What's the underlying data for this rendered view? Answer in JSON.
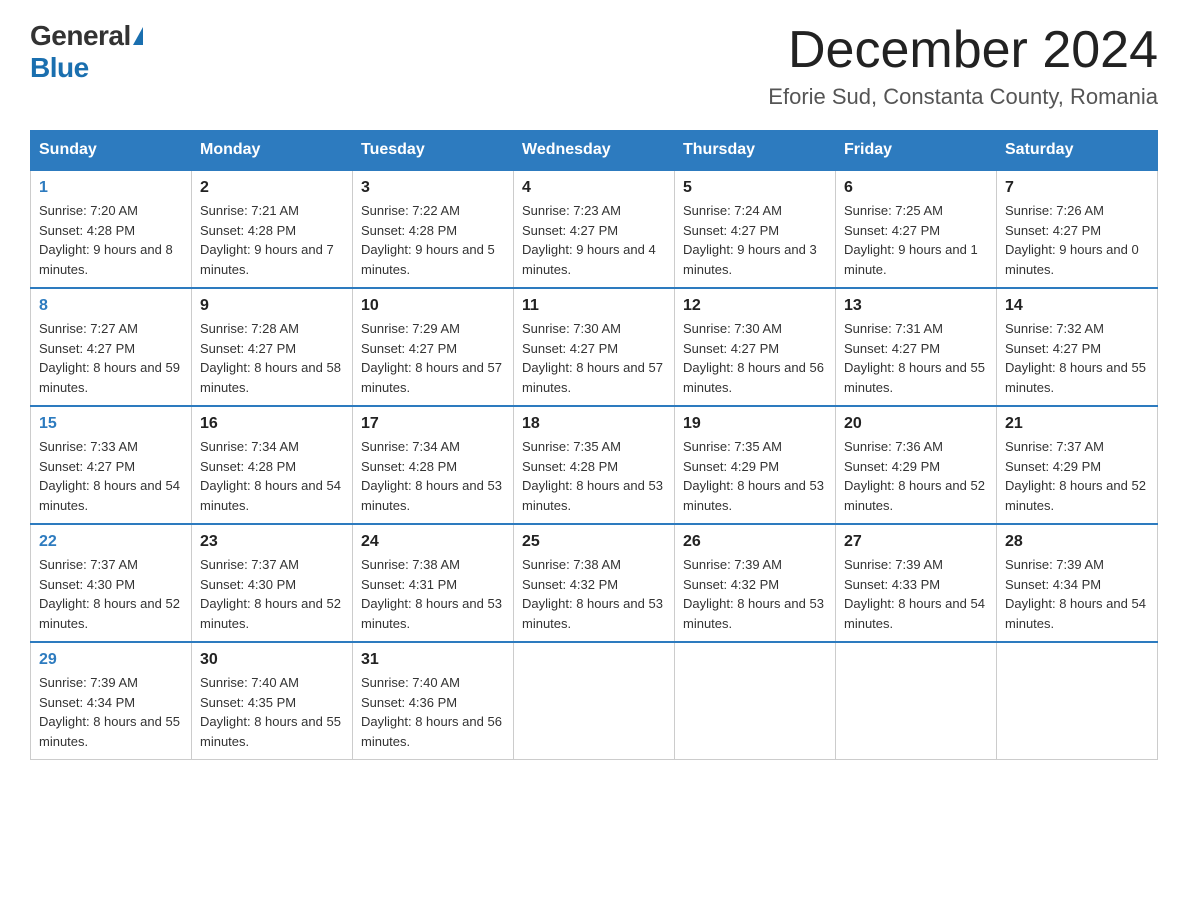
{
  "header": {
    "logo_general": "General",
    "logo_blue": "Blue",
    "month_title": "December 2024",
    "location": "Eforie Sud, Constanta County, Romania"
  },
  "days_of_week": [
    "Sunday",
    "Monday",
    "Tuesday",
    "Wednesday",
    "Thursday",
    "Friday",
    "Saturday"
  ],
  "weeks": [
    [
      {
        "day": "1",
        "sunrise": "7:20 AM",
        "sunset": "4:28 PM",
        "daylight": "9 hours and 8 minutes."
      },
      {
        "day": "2",
        "sunrise": "7:21 AM",
        "sunset": "4:28 PM",
        "daylight": "9 hours and 7 minutes."
      },
      {
        "day": "3",
        "sunrise": "7:22 AM",
        "sunset": "4:28 PM",
        "daylight": "9 hours and 5 minutes."
      },
      {
        "day": "4",
        "sunrise": "7:23 AM",
        "sunset": "4:27 PM",
        "daylight": "9 hours and 4 minutes."
      },
      {
        "day": "5",
        "sunrise": "7:24 AM",
        "sunset": "4:27 PM",
        "daylight": "9 hours and 3 minutes."
      },
      {
        "day": "6",
        "sunrise": "7:25 AM",
        "sunset": "4:27 PM",
        "daylight": "9 hours and 1 minute."
      },
      {
        "day": "7",
        "sunrise": "7:26 AM",
        "sunset": "4:27 PM",
        "daylight": "9 hours and 0 minutes."
      }
    ],
    [
      {
        "day": "8",
        "sunrise": "7:27 AM",
        "sunset": "4:27 PM",
        "daylight": "8 hours and 59 minutes."
      },
      {
        "day": "9",
        "sunrise": "7:28 AM",
        "sunset": "4:27 PM",
        "daylight": "8 hours and 58 minutes."
      },
      {
        "day": "10",
        "sunrise": "7:29 AM",
        "sunset": "4:27 PM",
        "daylight": "8 hours and 57 minutes."
      },
      {
        "day": "11",
        "sunrise": "7:30 AM",
        "sunset": "4:27 PM",
        "daylight": "8 hours and 57 minutes."
      },
      {
        "day": "12",
        "sunrise": "7:30 AM",
        "sunset": "4:27 PM",
        "daylight": "8 hours and 56 minutes."
      },
      {
        "day": "13",
        "sunrise": "7:31 AM",
        "sunset": "4:27 PM",
        "daylight": "8 hours and 55 minutes."
      },
      {
        "day": "14",
        "sunrise": "7:32 AM",
        "sunset": "4:27 PM",
        "daylight": "8 hours and 55 minutes."
      }
    ],
    [
      {
        "day": "15",
        "sunrise": "7:33 AM",
        "sunset": "4:27 PM",
        "daylight": "8 hours and 54 minutes."
      },
      {
        "day": "16",
        "sunrise": "7:34 AM",
        "sunset": "4:28 PM",
        "daylight": "8 hours and 54 minutes."
      },
      {
        "day": "17",
        "sunrise": "7:34 AM",
        "sunset": "4:28 PM",
        "daylight": "8 hours and 53 minutes."
      },
      {
        "day": "18",
        "sunrise": "7:35 AM",
        "sunset": "4:28 PM",
        "daylight": "8 hours and 53 minutes."
      },
      {
        "day": "19",
        "sunrise": "7:35 AM",
        "sunset": "4:29 PM",
        "daylight": "8 hours and 53 minutes."
      },
      {
        "day": "20",
        "sunrise": "7:36 AM",
        "sunset": "4:29 PM",
        "daylight": "8 hours and 52 minutes."
      },
      {
        "day": "21",
        "sunrise": "7:37 AM",
        "sunset": "4:29 PM",
        "daylight": "8 hours and 52 minutes."
      }
    ],
    [
      {
        "day": "22",
        "sunrise": "7:37 AM",
        "sunset": "4:30 PM",
        "daylight": "8 hours and 52 minutes."
      },
      {
        "day": "23",
        "sunrise": "7:37 AM",
        "sunset": "4:30 PM",
        "daylight": "8 hours and 52 minutes."
      },
      {
        "day": "24",
        "sunrise": "7:38 AM",
        "sunset": "4:31 PM",
        "daylight": "8 hours and 53 minutes."
      },
      {
        "day": "25",
        "sunrise": "7:38 AM",
        "sunset": "4:32 PM",
        "daylight": "8 hours and 53 minutes."
      },
      {
        "day": "26",
        "sunrise": "7:39 AM",
        "sunset": "4:32 PM",
        "daylight": "8 hours and 53 minutes."
      },
      {
        "day": "27",
        "sunrise": "7:39 AM",
        "sunset": "4:33 PM",
        "daylight": "8 hours and 54 minutes."
      },
      {
        "day": "28",
        "sunrise": "7:39 AM",
        "sunset": "4:34 PM",
        "daylight": "8 hours and 54 minutes."
      }
    ],
    [
      {
        "day": "29",
        "sunrise": "7:39 AM",
        "sunset": "4:34 PM",
        "daylight": "8 hours and 55 minutes."
      },
      {
        "day": "30",
        "sunrise": "7:40 AM",
        "sunset": "4:35 PM",
        "daylight": "8 hours and 55 minutes."
      },
      {
        "day": "31",
        "sunrise": "7:40 AM",
        "sunset": "4:36 PM",
        "daylight": "8 hours and 56 minutes."
      },
      null,
      null,
      null,
      null
    ]
  ]
}
